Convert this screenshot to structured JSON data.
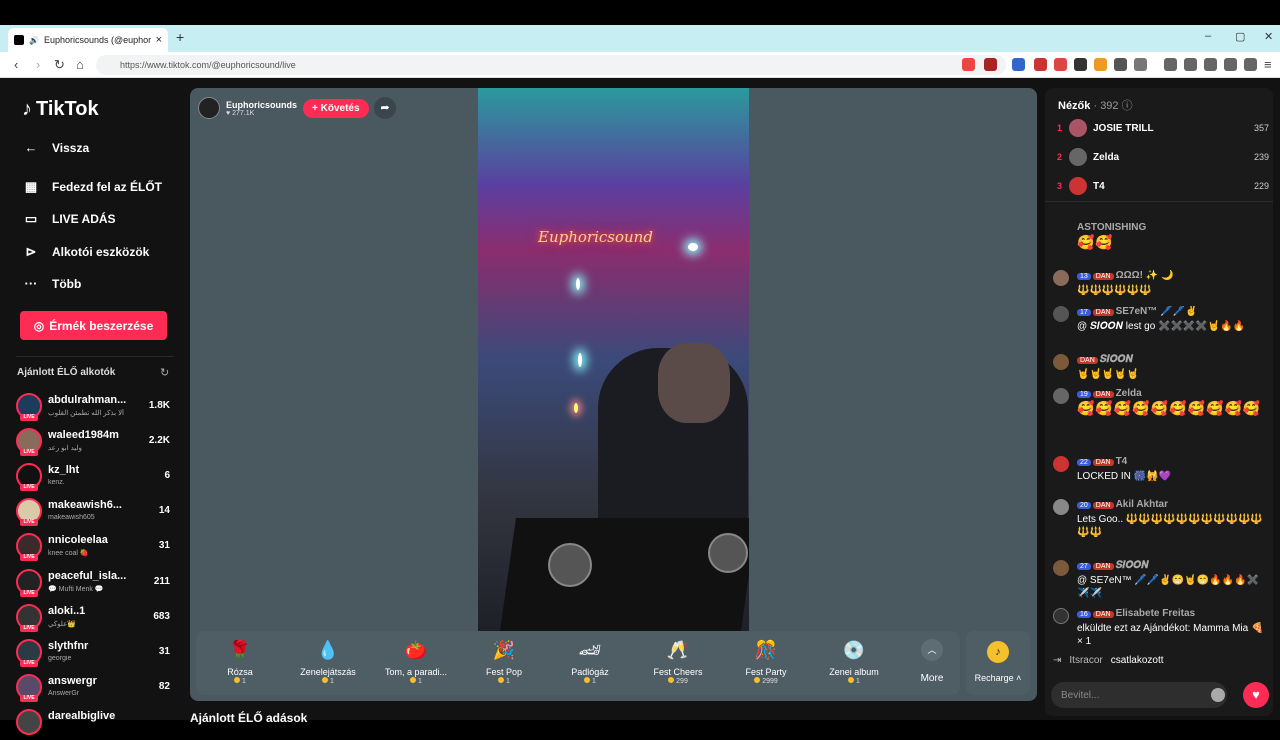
{
  "browser": {
    "tab_title": "Euphoricsounds (@euphoricsou",
    "url": "https://www.tiktok.com/@euphoricsound/live",
    "new_tab": "+",
    "close_tab": "×",
    "minimize": "–",
    "maximize": "▢",
    "close": "✕"
  },
  "sidebar": {
    "logo": "TikTok",
    "back": "Vissza",
    "nav": [
      {
        "label": "Fedezd fel az ÉLŐT",
        "icon": "calendar-icon"
      },
      {
        "label": "LIVE ADÁS",
        "icon": "camera-icon"
      },
      {
        "label": "Alkotói eszközök",
        "icon": "play-box-icon"
      },
      {
        "label": "Több",
        "icon": "more-icon"
      }
    ],
    "coin_button": "Érmék beszerzése",
    "section_title": "Ajánlott ÉLŐ alkotók",
    "creators": [
      {
        "name": "abdulrahman...",
        "sub": "ألا بذكر الله تطمئن القلوب",
        "count": "1.8K"
      },
      {
        "name": "waleed1984m",
        "sub": "وليد ابو رعد",
        "count": "2.2K"
      },
      {
        "name": "kz_lht",
        "sub": "kenz.",
        "count": "6"
      },
      {
        "name": "makeawish6...",
        "sub": "makeawish605",
        "count": "14"
      },
      {
        "name": "nnicoleelaa",
        "sub": "knee coal 🍓",
        "count": "31"
      },
      {
        "name": "peaceful_isla...",
        "sub": "💬 Mufti Menk 💬",
        "count": "211"
      },
      {
        "name": "aloki..1",
        "sub": "علوكي👑",
        "count": "683"
      },
      {
        "name": "slythfnr",
        "sub": "georgie",
        "count": "31"
      },
      {
        "name": "answergr",
        "sub": "AnswerGr",
        "count": "82"
      },
      {
        "name": "darealbiglive",
        "sub": "",
        "count": ""
      }
    ]
  },
  "stream": {
    "host_name": "Euphoricsounds",
    "host_likes": "♥ 277.1K",
    "follow": "+ Követés",
    "neon_sign": "Euphoricsound",
    "gifts": [
      {
        "name": "Rózsa",
        "price": "1",
        "icon": "rose-icon",
        "glyph": "🌹"
      },
      {
        "name": "Zenelejátszás",
        "price": "1",
        "icon": "music-drop-icon",
        "glyph": "💧"
      },
      {
        "name": "Tom, a paradi...",
        "price": "1",
        "icon": "tomato-icon",
        "glyph": "🍅"
      },
      {
        "name": "Fest Pop",
        "price": "1",
        "icon": "fest-pop-icon",
        "glyph": "🎉"
      },
      {
        "name": "Padlógáz",
        "price": "1",
        "icon": "speedometer-icon",
        "glyph": "🏎"
      },
      {
        "name": "Fest Cheers",
        "price": "299",
        "icon": "fest-cheers-icon",
        "glyph": "🥂"
      },
      {
        "name": "Fest Party",
        "price": "2999",
        "icon": "fest-party-icon",
        "glyph": "🎊"
      },
      {
        "name": "Zenei album",
        "price": "1",
        "icon": "album-icon",
        "glyph": "💿"
      }
    ],
    "more": "More",
    "recharge": "Recharge",
    "below_title": "Ajánlott ÉLŐ adások"
  },
  "panel": {
    "viewers_title": "Nézők",
    "viewers_count": "· 392",
    "top_viewers": [
      {
        "rank": "1",
        "name": "JOSIE TRILL",
        "score": "357"
      },
      {
        "rank": "2",
        "name": "Zelda",
        "score": "239"
      },
      {
        "rank": "3",
        "name": "T4",
        "score": "229"
      }
    ],
    "chat": [
      {
        "level": "",
        "badge": "",
        "user": "ASTONISHING",
        "text": "🥰🥰"
      },
      {
        "level": "13",
        "badge": "DAN",
        "user": "ΩΩΩ! ✨ 🌙",
        "text": "🔱🔱🔱🔱🔱🔱"
      },
      {
        "level": "17",
        "badge": "DAN",
        "user": "SE7eN™ 🖊️🖊️✌️",
        "text": "@ 𝑺𝑰𝑶𝑶𝑵 lest go ✖️✖️✖️✖️🤘🔥🔥"
      },
      {
        "level": "",
        "badge": "DAN",
        "user": "𝑺𝑰𝑶𝑶𝑵",
        "text": "🤘🤘🤘🤘🤘"
      },
      {
        "level": "19",
        "badge": "DAN",
        "user": "Zelda",
        "text": "🥰🥰🥰🥰🥰🥰🥰🥰🥰🥰"
      },
      {
        "level": "22",
        "badge": "DAN",
        "user": "T4",
        "text": "LOCKED IN 🎆🙀💜"
      },
      {
        "level": "20",
        "badge": "DAN",
        "user": "Akil Akhtar",
        "text": "Lets Goo.. 🔱🔱🔱🔱🔱🔱🔱🔱🔱🔱🔱🔱🔱"
      },
      {
        "level": "27",
        "badge": "DAN",
        "user": "𝑺𝑰𝑶𝑶𝑵",
        "text": "@ SE7eN™ 🖊️🖊️✌️😁🤘😁🔥🔥🔥✖️✈️✈️"
      },
      {
        "level": "16",
        "badge": "DAN",
        "user": "Elisabete Freitas",
        "text": "elküldte ezt az Ajándékot: Mamma Mia 🍕 × 1"
      }
    ],
    "joined_user": "Itsracor",
    "joined_text": "csatlakozott",
    "input_placeholder": "Bevitel..."
  }
}
